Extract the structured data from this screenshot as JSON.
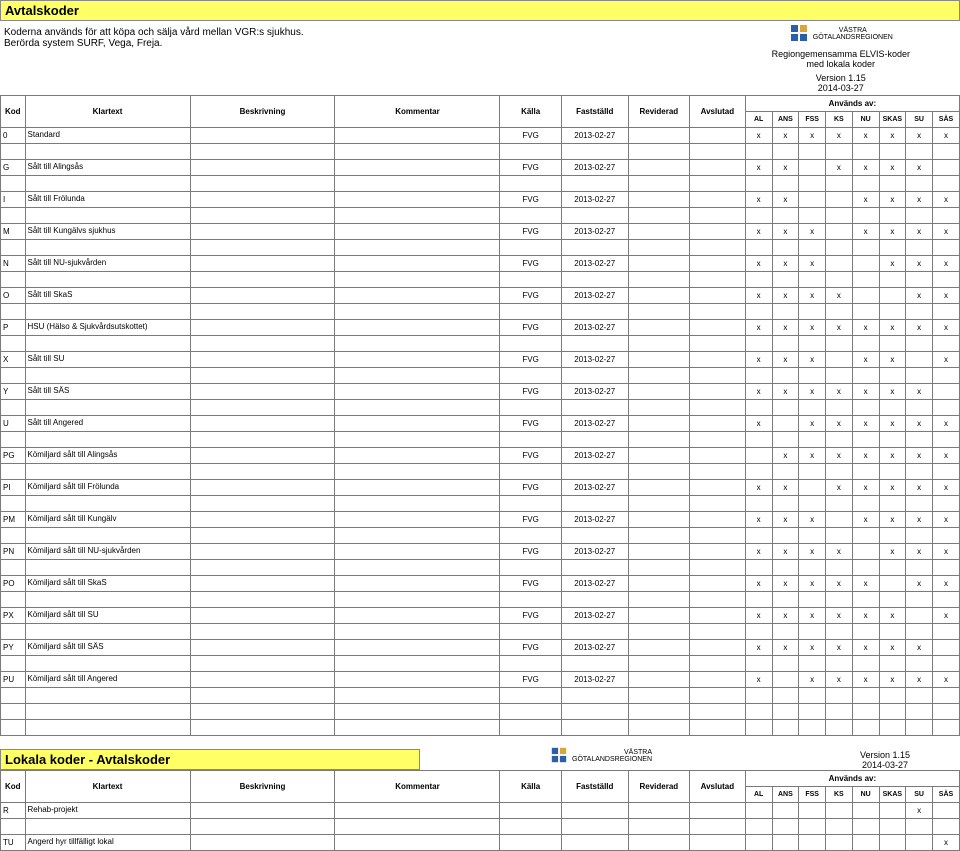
{
  "title": "Avtalskoder",
  "desc1": "Koderna används för att köpa och sälja vård mellan VGR:s sjukhus.",
  "desc2": "Berörda system SURF, Vega, Freja.",
  "logo_text": "VÄSTRA\nGÖTALANDSREGIONEN",
  "banner_line1": "Regiongemensamma ELVIS-koder",
  "banner_line2": "med lokala koder",
  "version": "Version 1.15",
  "date": "2014-03-27",
  "anvands_av": "Används av:",
  "headers": {
    "kod": "Kod",
    "klartext": "Klartext",
    "beskrivning": "Beskrivning",
    "kommentar": "Kommentar",
    "kalla": "Källa",
    "faststalld": "Fastställd",
    "reviderad": "Reviderad",
    "avslutad": "Avslutad",
    "chk": [
      "AL",
      "ANS",
      "FSS",
      "KS",
      "NU",
      "SKAS",
      "SU",
      "SÄS"
    ]
  },
  "rows": [
    {
      "kod": "0",
      "klar": "Standard",
      "kalla": "FVG",
      "fast": "2013-02-27",
      "chk": [
        1,
        1,
        1,
        1,
        1,
        1,
        1,
        1
      ]
    },
    {
      "blank": true
    },
    {
      "kod": "G",
      "klar": "Sålt till Alingsås",
      "kalla": "FVG",
      "fast": "2013-02-27",
      "chk": [
        1,
        1,
        0,
        1,
        1,
        1,
        1,
        0
      ]
    },
    {
      "blank": true
    },
    {
      "kod": "I",
      "klar": "Sålt till Frölunda",
      "kalla": "FVG",
      "fast": "2013-02-27",
      "chk": [
        1,
        1,
        0,
        0,
        1,
        1,
        1,
        1
      ]
    },
    {
      "blank": true
    },
    {
      "kod": "M",
      "klar": "Sålt till Kungälvs sjukhus",
      "kalla": "FVG",
      "fast": "2013-02-27",
      "chk": [
        1,
        1,
        1,
        0,
        1,
        1,
        1,
        1
      ]
    },
    {
      "blank": true
    },
    {
      "kod": "N",
      "klar": "Sålt till NU-sjukvården",
      "kalla": "FVG",
      "fast": "2013-02-27",
      "chk": [
        1,
        1,
        1,
        0,
        0,
        1,
        1,
        1
      ]
    },
    {
      "blank": true
    },
    {
      "kod": "O",
      "klar": "Sålt till SkaS",
      "kalla": "FVG",
      "fast": "2013-02-27",
      "chk": [
        1,
        1,
        1,
        1,
        0,
        0,
        1,
        1
      ]
    },
    {
      "blank": true
    },
    {
      "kod": "P",
      "klar": "HSU (Hälso & Sjukvårdsutskottet)",
      "kalla": "FVG",
      "fast": "2013-02-27",
      "chk": [
        1,
        1,
        1,
        1,
        1,
        1,
        1,
        1
      ]
    },
    {
      "blank": true
    },
    {
      "kod": "X",
      "klar": "Sålt till SU",
      "kalla": "FVG",
      "fast": "2013-02-27",
      "chk": [
        1,
        1,
        1,
        0,
        1,
        1,
        0,
        1
      ]
    },
    {
      "blank": true
    },
    {
      "kod": "Y",
      "klar": "Sålt till SÄS",
      "kalla": "FVG",
      "fast": "2013-02-27",
      "chk": [
        1,
        1,
        1,
        1,
        1,
        1,
        1,
        0
      ]
    },
    {
      "blank": true
    },
    {
      "kod": "U",
      "klar": "Sålt till Angered",
      "kalla": "FVG",
      "fast": "2013-02-27",
      "chk": [
        1,
        0,
        1,
        1,
        1,
        1,
        1,
        1
      ]
    },
    {
      "blank": true
    },
    {
      "kod": "PG",
      "klar": "Kömiljard sålt till Alingsås",
      "kalla": "FVG",
      "fast": "2013-02-27",
      "chk": [
        0,
        1,
        1,
        1,
        1,
        1,
        1,
        1
      ]
    },
    {
      "blank": true
    },
    {
      "kod": "PI",
      "klar": "Kömiljard sålt till Frölunda",
      "kalla": "FVG",
      "fast": "2013-02-27",
      "chk": [
        1,
        1,
        0,
        1,
        1,
        1,
        1,
        1
      ]
    },
    {
      "blank": true
    },
    {
      "kod": "PM",
      "klar": "Kömiljard sålt till Kungälv",
      "kalla": "FVG",
      "fast": "2013-02-27",
      "chk": [
        1,
        1,
        1,
        0,
        1,
        1,
        1,
        1
      ]
    },
    {
      "blank": true
    },
    {
      "kod": "PN",
      "klar": "Kömiljard sålt till NU-sjukvården",
      "kalla": "FVG",
      "fast": "2013-02-27",
      "chk": [
        1,
        1,
        1,
        1,
        0,
        1,
        1,
        1
      ]
    },
    {
      "blank": true
    },
    {
      "kod": "PO",
      "klar": "Kömiljard sålt till SkaS",
      "kalla": "FVG",
      "fast": "2013-02-27",
      "chk": [
        1,
        1,
        1,
        1,
        1,
        0,
        1,
        1
      ]
    },
    {
      "blank": true
    },
    {
      "kod": "PX",
      "klar": "Kömiljard sålt till SU",
      "kalla": "FVG",
      "fast": "2013-02-27",
      "chk": [
        1,
        1,
        1,
        1,
        1,
        1,
        0,
        1
      ]
    },
    {
      "blank": true
    },
    {
      "kod": "PY",
      "klar": "Kömiljard sålt till SÄS",
      "kalla": "FVG",
      "fast": "2013-02-27",
      "chk": [
        1,
        1,
        1,
        1,
        1,
        1,
        1,
        0
      ]
    },
    {
      "blank": true
    },
    {
      "kod": "PU",
      "klar": "Kömiljard sålt till Angered",
      "kalla": "FVG",
      "fast": "2013-02-27",
      "chk": [
        1,
        0,
        1,
        1,
        1,
        1,
        1,
        1
      ]
    },
    {
      "blank": true
    },
    {
      "blank": true
    },
    {
      "blank": true
    }
  ],
  "lokala_title": "Lokala koder - Avtalskoder",
  "lokala_rows": [
    {
      "kod": "R",
      "klar": "Rehab-projekt",
      "kalla": "",
      "fast": "",
      "chk": [
        0,
        0,
        0,
        0,
        0,
        0,
        1,
        0
      ]
    },
    {
      "blank": true
    },
    {
      "kod": "TU",
      "klar": "Angerd hyr tillfälligt lokal",
      "kalla": "",
      "fast": "",
      "chk": [
        0,
        0,
        0,
        0,
        0,
        0,
        0,
        1
      ]
    }
  ]
}
